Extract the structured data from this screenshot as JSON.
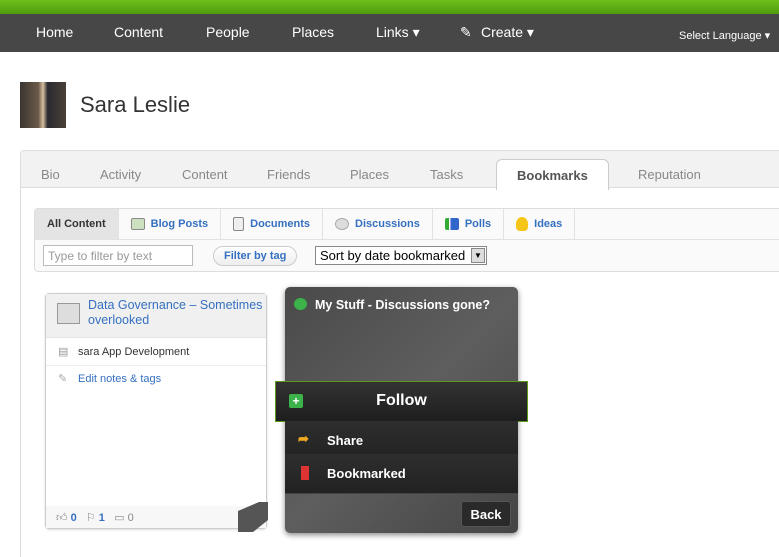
{
  "nav": {
    "items": [
      "Home",
      "Content",
      "People",
      "Places",
      "Links ▾",
      "Create ▾"
    ],
    "language": "Select Language ▾"
  },
  "profile": {
    "name": "Sara Leslie"
  },
  "tabs": [
    "Bio",
    "Activity",
    "Content",
    "Friends",
    "Places",
    "Tasks",
    "Bookmarks",
    "Reputation"
  ],
  "subtabs": [
    "All Content",
    "Blog Posts",
    "Documents",
    "Discussions",
    "Polls",
    "Ideas"
  ],
  "filter": {
    "placeholder": "Type to filter by text",
    "tag_button": "Filter by tag",
    "sort": "Sort by date bookmarked"
  },
  "card": {
    "title": "Data Governance – Sometimes overlooked",
    "place": "sara App Development",
    "edit": "Edit notes & tags",
    "likes": "0",
    "bookmarks": "1",
    "comments": "0"
  },
  "menu": {
    "title": "My Stuff - Discussions gone?",
    "follow": "Follow",
    "share": "Share",
    "bookmarked": "Bookmarked",
    "back": "Back"
  }
}
